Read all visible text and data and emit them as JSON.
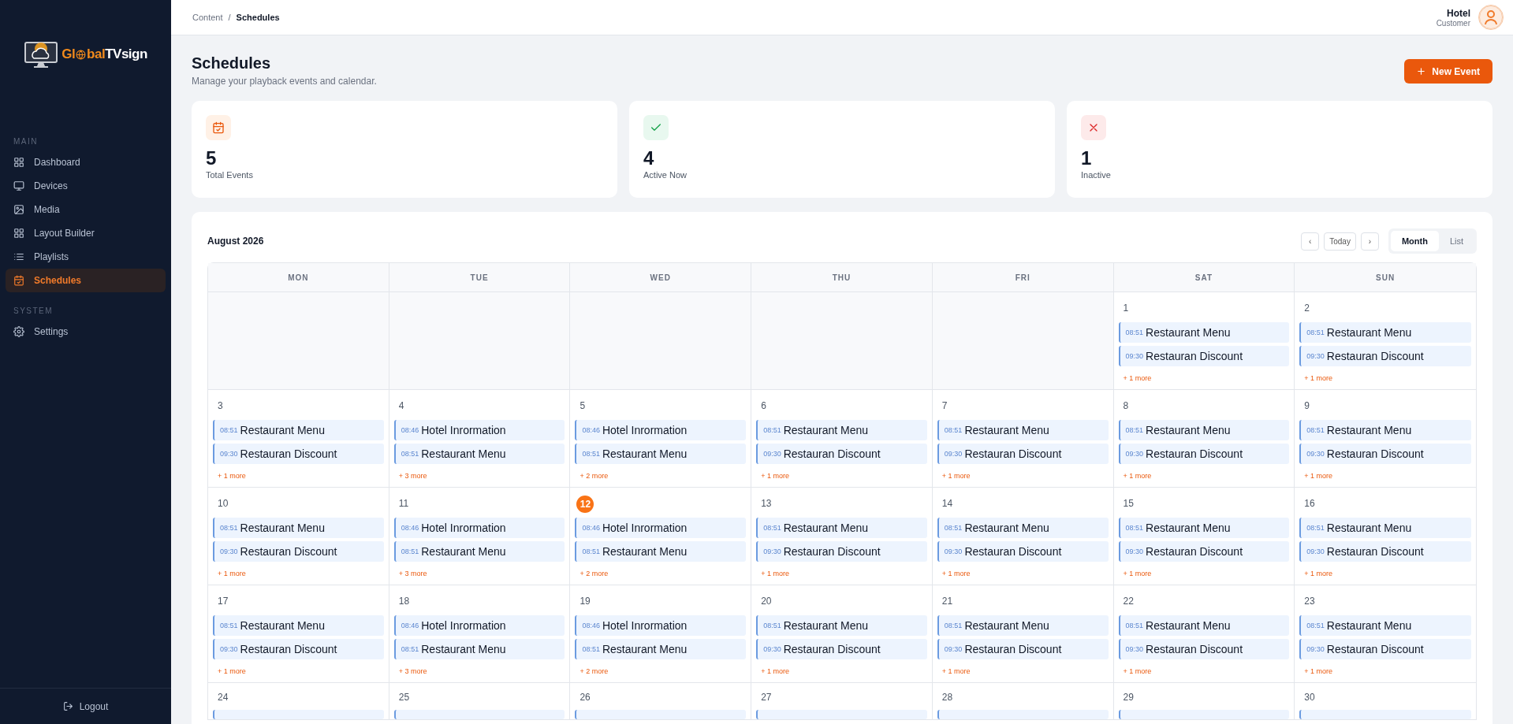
{
  "sidebar": {
    "logo": {
      "start": "Gl",
      "middle": "bal",
      "end": "TVsign"
    },
    "sections": [
      {
        "label": "MAIN",
        "items": [
          {
            "label": "Dashboard",
            "selected": false
          },
          {
            "label": "Devices",
            "selected": false
          },
          {
            "label": "Media",
            "selected": false
          },
          {
            "label": "Layout Builder",
            "selected": false
          },
          {
            "label": "Playlists",
            "selected": false
          },
          {
            "label": "Schedules",
            "selected": true
          }
        ]
      },
      {
        "label": "SYSTEM",
        "items": [
          {
            "label": "Settings",
            "selected": false
          }
        ]
      }
    ],
    "logout": "Logout"
  },
  "header": {
    "breadcrumb": [
      "Content",
      "Schedules"
    ],
    "separator": "/",
    "user": {
      "name": "Hotel",
      "role": "Customer"
    }
  },
  "page": {
    "title": "Schedules",
    "subtitle": "Manage your playback events and calendar.",
    "action": "New Event"
  },
  "stats": [
    {
      "kind": "calendar",
      "value": "5",
      "label": "Total Events"
    },
    {
      "kind": "check",
      "value": "4",
      "label": "Active Now"
    },
    {
      "kind": "cross",
      "value": "1",
      "label": "Inactive"
    }
  ],
  "calendar": {
    "title": "August 2026",
    "prev": "‹",
    "today": "Today",
    "next": "›",
    "views": [
      {
        "label": "Month",
        "selected": true
      },
      {
        "label": "List",
        "selected": false
      }
    ],
    "weekdays": [
      "MON",
      "TUE",
      "WED",
      "THU",
      "FRI",
      "SAT",
      "SUN"
    ],
    "weeks": [
      {
        "cut": false,
        "days": [
          {
            "day": "1",
            "today": false,
            "events": [
              {
                "time": "08:51",
                "title": "Restaurant Menu"
              },
              {
                "time": "09:30",
                "title": "Restauran Discount"
              }
            ],
            "more": "+ 1 more"
          },
          {
            "day": "2",
            "today": false,
            "events": [
              {
                "time": "08:51",
                "title": "Restaurant Menu"
              },
              {
                "time": "09:30",
                "title": "Restauran Discount"
              }
            ],
            "more": "+ 1 more"
          }
        ]
      },
      {
        "cut": false,
        "days": [
          {
            "day": "3",
            "today": false,
            "events": [
              {
                "time": "08:51",
                "title": "Restaurant Menu"
              },
              {
                "time": "09:30",
                "title": "Restauran Discount"
              }
            ],
            "more": "+ 1 more"
          },
          {
            "day": "4",
            "today": false,
            "events": [
              {
                "time": "08:46",
                "title": "Hotel Inrormation"
              },
              {
                "time": "08:51",
                "title": "Restaurant Menu"
              }
            ],
            "more": "+ 3 more"
          },
          {
            "day": "5",
            "today": false,
            "events": [
              {
                "time": "08:46",
                "title": "Hotel Inrormation"
              },
              {
                "time": "08:51",
                "title": "Restaurant Menu"
              }
            ],
            "more": "+ 2 more"
          },
          {
            "day": "6",
            "today": false,
            "events": [
              {
                "time": "08:51",
                "title": "Restaurant Menu"
              },
              {
                "time": "09:30",
                "title": "Restauran Discount"
              }
            ],
            "more": "+ 1 more"
          },
          {
            "day": "7",
            "today": false,
            "events": [
              {
                "time": "08:51",
                "title": "Restaurant Menu"
              },
              {
                "time": "09:30",
                "title": "Restauran Discount"
              }
            ],
            "more": "+ 1 more"
          },
          {
            "day": "8",
            "today": false,
            "events": [
              {
                "time": "08:51",
                "title": "Restaurant Menu"
              },
              {
                "time": "09:30",
                "title": "Restauran Discount"
              }
            ],
            "more": "+ 1 more"
          },
          {
            "day": "9",
            "today": false,
            "events": [
              {
                "time": "08:51",
                "title": "Restaurant Menu"
              },
              {
                "time": "09:30",
                "title": "Restauran Discount"
              }
            ],
            "more": "+ 1 more"
          }
        ]
      },
      {
        "cut": false,
        "days": [
          {
            "day": "10",
            "today": false,
            "events": [
              {
                "time": "08:51",
                "title": "Restaurant Menu"
              },
              {
                "time": "09:30",
                "title": "Restauran Discount"
              }
            ],
            "more": "+ 1 more"
          },
          {
            "day": "11",
            "today": false,
            "events": [
              {
                "time": "08:46",
                "title": "Hotel Inrormation"
              },
              {
                "time": "08:51",
                "title": "Restaurant Menu"
              }
            ],
            "more": "+ 3 more"
          },
          {
            "day": "12",
            "today": true,
            "events": [
              {
                "time": "08:46",
                "title": "Hotel Inrormation"
              },
              {
                "time": "08:51",
                "title": "Restaurant Menu"
              }
            ],
            "more": "+ 2 more"
          },
          {
            "day": "13",
            "today": false,
            "events": [
              {
                "time": "08:51",
                "title": "Restaurant Menu"
              },
              {
                "time": "09:30",
                "title": "Restauran Discount"
              }
            ],
            "more": "+ 1 more"
          },
          {
            "day": "14",
            "today": false,
            "events": [
              {
                "time": "08:51",
                "title": "Restaurant Menu"
              },
              {
                "time": "09:30",
                "title": "Restauran Discount"
              }
            ],
            "more": "+ 1 more"
          },
          {
            "day": "15",
            "today": false,
            "events": [
              {
                "time": "08:51",
                "title": "Restaurant Menu"
              },
              {
                "time": "09:30",
                "title": "Restauran Discount"
              }
            ],
            "more": "+ 1 more"
          },
          {
            "day": "16",
            "today": false,
            "events": [
              {
                "time": "08:51",
                "title": "Restaurant Menu"
              },
              {
                "time": "09:30",
                "title": "Restauran Discount"
              }
            ],
            "more": "+ 1 more"
          }
        ]
      },
      {
        "cut": false,
        "days": [
          {
            "day": "17",
            "today": false,
            "events": [
              {
                "time": "08:51",
                "title": "Restaurant Menu"
              },
              {
                "time": "09:30",
                "title": "Restauran Discount"
              }
            ],
            "more": "+ 1 more"
          },
          {
            "day": "18",
            "today": false,
            "events": [
              {
                "time": "08:46",
                "title": "Hotel Inrormation"
              },
              {
                "time": "08:51",
                "title": "Restaurant Menu"
              }
            ],
            "more": "+ 3 more"
          },
          {
            "day": "19",
            "today": false,
            "events": [
              {
                "time": "08:46",
                "title": "Hotel Inrormation"
              },
              {
                "time": "08:51",
                "title": "Restaurant Menu"
              }
            ],
            "more": "+ 2 more"
          },
          {
            "day": "20",
            "today": false,
            "events": [
              {
                "time": "08:51",
                "title": "Restaurant Menu"
              },
              {
                "time": "09:30",
                "title": "Restauran Discount"
              }
            ],
            "more": "+ 1 more"
          },
          {
            "day": "21",
            "today": false,
            "events": [
              {
                "time": "08:51",
                "title": "Restaurant Menu"
              },
              {
                "time": "09:30",
                "title": "Restauran Discount"
              }
            ],
            "more": "+ 1 more"
          },
          {
            "day": "22",
            "today": false,
            "events": [
              {
                "time": "08:51",
                "title": "Restaurant Menu"
              },
              {
                "time": "09:30",
                "title": "Restauran Discount"
              }
            ],
            "more": "+ 1 more"
          },
          {
            "day": "23",
            "today": false,
            "events": [
              {
                "time": "08:51",
                "title": "Restaurant Menu"
              },
              {
                "time": "09:30",
                "title": "Restauran Discount"
              }
            ],
            "more": "+ 1 more"
          }
        ]
      },
      {
        "cut": true,
        "days": [
          {
            "day": "24",
            "today": false
          },
          {
            "day": "25",
            "today": false
          },
          {
            "day": "26",
            "today": false
          },
          {
            "day": "27",
            "today": false
          },
          {
            "day": "28",
            "today": false
          },
          {
            "day": "29",
            "today": false
          },
          {
            "day": "30",
            "today": false
          }
        ]
      }
    ]
  }
}
